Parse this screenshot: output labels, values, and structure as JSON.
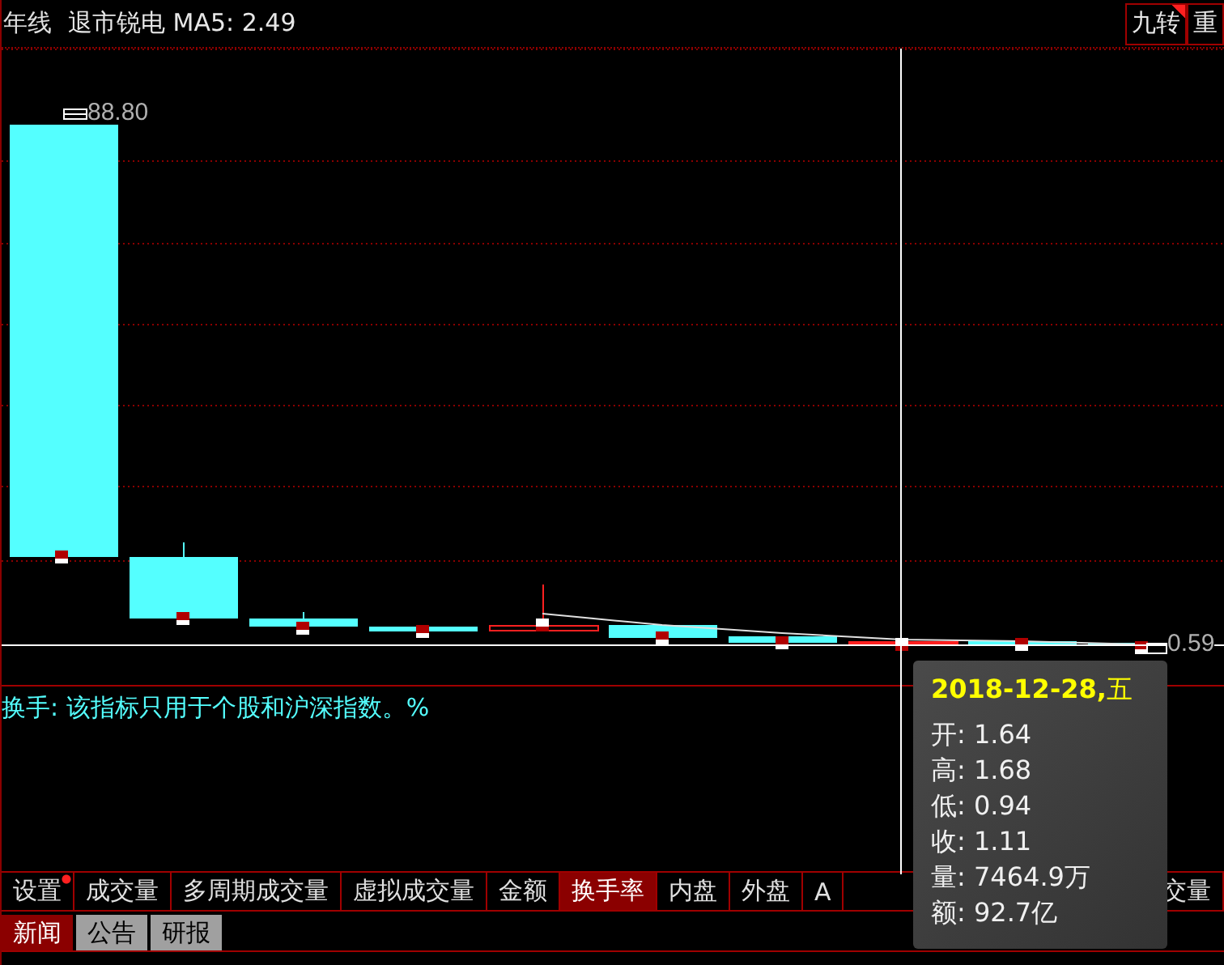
{
  "header": {
    "period": "年线",
    "title": "退市锐电 MA5: 2.49",
    "buttons": [
      {
        "label": "九转",
        "flagged": true
      },
      {
        "label": "重",
        "flagged": false
      }
    ]
  },
  "chart": {
    "high_label": "88.80",
    "low_label": "0.59"
  },
  "indicator": {
    "text": "换手: 该指标只用于个股和沪深指数。%"
  },
  "indicator_tabs": [
    {
      "label": "设置",
      "selected": false,
      "dot": true
    },
    {
      "label": "成交量",
      "selected": false,
      "dot": false
    },
    {
      "label": "多周期成交量",
      "selected": false,
      "dot": false
    },
    {
      "label": "虚拟成交量",
      "selected": false,
      "dot": false
    },
    {
      "label": "金额",
      "selected": false,
      "dot": false
    },
    {
      "label": "换手率",
      "selected": true,
      "dot": false
    },
    {
      "label": "内盘",
      "selected": false,
      "dot": false
    },
    {
      "label": "外盘",
      "selected": false,
      "dot": false
    },
    {
      "label": "A",
      "selected": false,
      "dot": false
    },
    {
      "label": "交量",
      "selected": false,
      "dot": false
    }
  ],
  "info_tabs": [
    {
      "label": "新闻",
      "selected": true
    },
    {
      "label": "公告",
      "selected": false
    },
    {
      "label": "研报",
      "selected": false
    }
  ],
  "tooltip": {
    "date": "**2018-12-28,**五",
    "rows": [
      "开: 1.64",
      "高: 1.68",
      "低: 0.94",
      "收: 1.11",
      "量: 7464.9万",
      "额: 92.7亿"
    ]
  }
}
